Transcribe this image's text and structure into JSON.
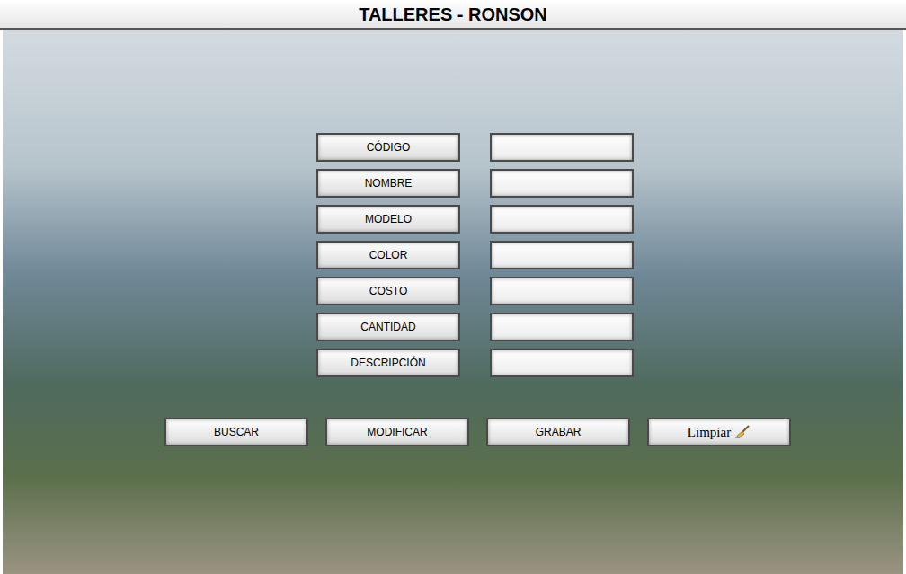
{
  "window": {
    "title": "TALLERES - RONSON"
  },
  "fields": [
    {
      "label": "CÓDIGO",
      "value": ""
    },
    {
      "label": "NOMBRE",
      "value": ""
    },
    {
      "label": "MODELO",
      "value": ""
    },
    {
      "label": "COLOR",
      "value": ""
    },
    {
      "label": "COSTO",
      "value": ""
    },
    {
      "label": "CANTIDAD",
      "value": ""
    },
    {
      "label": "DESCRIPCIÓN",
      "value": ""
    }
  ],
  "buttons": [
    {
      "label": "BUSCAR",
      "kind": "text"
    },
    {
      "label": "MODIFICAR",
      "kind": "text"
    },
    {
      "label": "GRABAR",
      "kind": "text"
    },
    {
      "label": "Limpiar",
      "kind": "icon"
    }
  ]
}
